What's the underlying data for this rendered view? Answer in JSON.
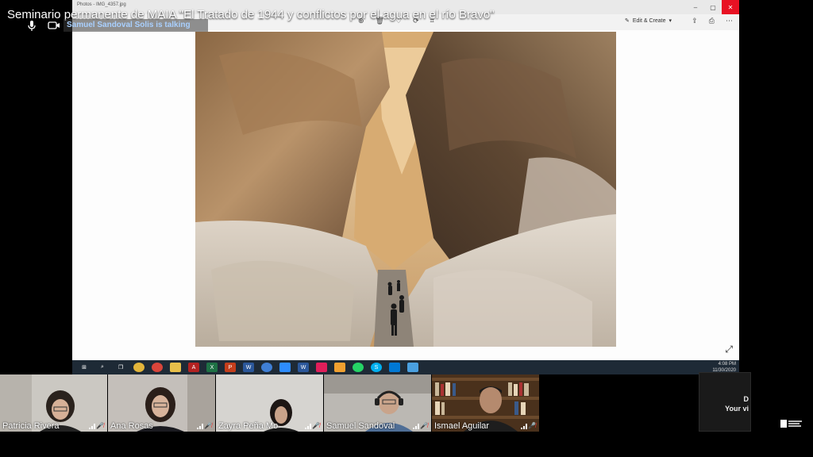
{
  "meeting": {
    "title": "Seminario permanente de MAIA \"El Tratado de 1944 y conflictos por el agua en el río Bravo\"",
    "talking_indicator": "Samuel Sandoval Solis is talking"
  },
  "shared_screen": {
    "app_title": "Photos - IMG_4357.jpg",
    "edit_create_label": "Edit & Create",
    "clock_time": "4:08 PM",
    "clock_date": "11/30/2020",
    "photo_icon": "canyon-photo"
  },
  "participants": [
    {
      "name": "Patricia Rivera",
      "bg": "#c9c6c0",
      "shirt": "#222"
    },
    {
      "name": "Ana Rosas",
      "bg": "#c2bdb8",
      "shirt": "#1b1b20"
    },
    {
      "name": "Zayra Peña Mo",
      "bg": "#d4d2cf",
      "shirt": "#1a1a1a"
    },
    {
      "name": "Samuel Sandoval",
      "bg": "#b9b7b2",
      "shirt": "#4f6e96"
    },
    {
      "name": "Ismael Aguilar",
      "bg": "#5a3b22",
      "shirt": "#1e1e1e"
    }
  ],
  "self_view": {
    "line1": "D",
    "line2": "Your vi"
  },
  "colors": {
    "muted": "#e33b3b",
    "talking": "#a9d0ff",
    "taskbar": "#1e2a36"
  }
}
